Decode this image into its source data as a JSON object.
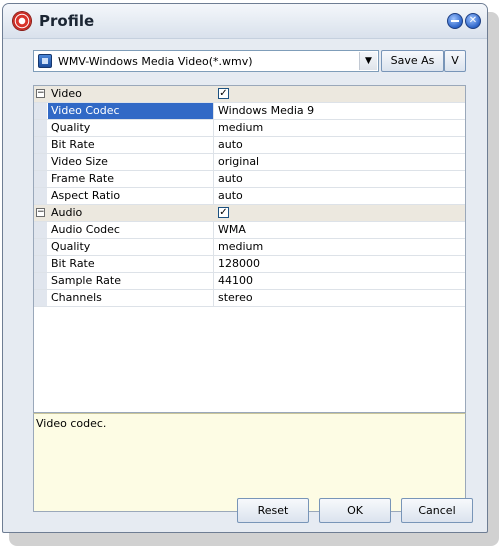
{
  "window": {
    "title": "Profile"
  },
  "profile": {
    "selected": "WMV-Windows Media Video(*.wmv)",
    "save_as_label": "Save As",
    "v_label": "V"
  },
  "grid": {
    "categories": [
      {
        "label": "Video",
        "checked": true,
        "rows": [
          {
            "name": "Video Codec",
            "value": "Windows Media 9",
            "selected": true
          },
          {
            "name": "Quality",
            "value": "medium"
          },
          {
            "name": "Bit Rate",
            "value": "auto"
          },
          {
            "name": "Video Size",
            "value": "original"
          },
          {
            "name": "Frame Rate",
            "value": "auto"
          },
          {
            "name": "Aspect Ratio",
            "value": "auto"
          }
        ]
      },
      {
        "label": "Audio",
        "checked": true,
        "rows": [
          {
            "name": "Audio Codec",
            "value": "WMA"
          },
          {
            "name": "Quality",
            "value": "medium"
          },
          {
            "name": "Bit Rate",
            "value": "128000"
          },
          {
            "name": "Sample Rate",
            "value": "44100"
          },
          {
            "name": "Channels",
            "value": "stereo"
          }
        ]
      }
    ]
  },
  "description": "Video codec.",
  "buttons": {
    "reset": "Reset",
    "ok": "OK",
    "cancel": "Cancel"
  },
  "icons": {
    "app": "profile-gear-icon",
    "minimize": "minimize-icon",
    "close": "close-icon",
    "format": "video-file-icon",
    "dropdown": "chevron-down-icon",
    "expand": "collapse-icon",
    "check": "checkmark-icon"
  }
}
